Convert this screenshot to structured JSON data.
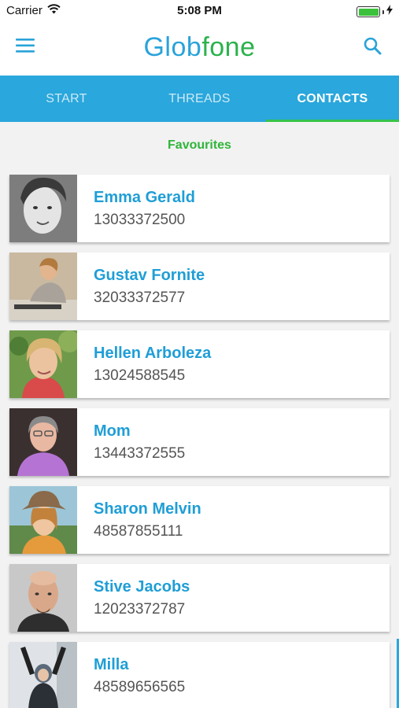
{
  "status_bar": {
    "carrier": "Carrier",
    "time": "5:08 PM",
    "battery_level": 1.0
  },
  "header": {
    "logo_text": "Globfone",
    "menu_icon": "hamburger-menu-icon",
    "search_icon": "search-icon"
  },
  "tabs": [
    {
      "label": "START",
      "active": false
    },
    {
      "label": "THREADS",
      "active": false
    },
    {
      "label": "CONTACTS",
      "active": true
    }
  ],
  "section_title": "Favourites",
  "contacts": [
    {
      "name": "Emma Gerald",
      "phone": "13033372500"
    },
    {
      "name": "Gustav Fornite",
      "phone": "32033372577"
    },
    {
      "name": "Hellen Arboleza",
      "phone": "13024588545"
    },
    {
      "name": "Mom",
      "phone": "13443372555"
    },
    {
      "name": "Sharon Melvin",
      "phone": "48587855111"
    },
    {
      "name": "Stive Jacobs",
      "phone": "12023372787"
    },
    {
      "name": "Milla",
      "phone": "48589656565"
    }
  ],
  "colors": {
    "accent": "#2aa7dc",
    "tab_indicator": "#37c44a",
    "favourites": "#2fb53a",
    "contact_name": "#1f9ed6"
  }
}
